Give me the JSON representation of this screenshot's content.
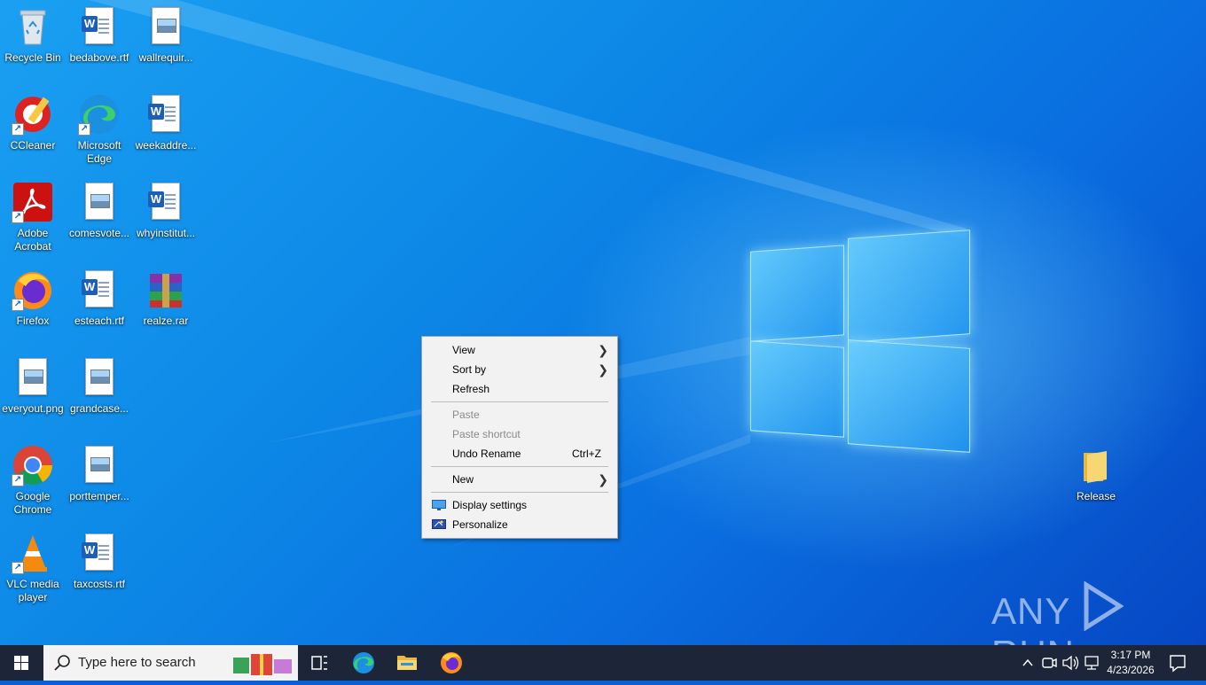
{
  "desktop": {
    "icons": [
      {
        "label": "Recycle Bin"
      },
      {
        "label": "bedabove.rtf"
      },
      {
        "label": "wallrequir..."
      },
      {
        "label": "CCleaner"
      },
      {
        "label": "Microsoft Edge"
      },
      {
        "label": "weekaddre..."
      },
      {
        "label": "Adobe Acrobat"
      },
      {
        "label": "comesvote..."
      },
      {
        "label": "whyinstitut..."
      },
      {
        "label": "Firefox"
      },
      {
        "label": "esteach.rtf"
      },
      {
        "label": "realze.rar"
      },
      {
        "label": "everyout.png"
      },
      {
        "label": "grandcase..."
      },
      {
        "label": "Google Chrome"
      },
      {
        "label": "porttemper..."
      },
      {
        "label": "VLC media player"
      },
      {
        "label": "taxcosts.rtf"
      },
      {
        "label": "Release"
      }
    ],
    "watermark": {
      "left": "ANY",
      "right": "RUN"
    }
  },
  "context_menu": {
    "items": [
      {
        "label": "View",
        "has_submenu": true
      },
      {
        "label": "Sort by",
        "has_submenu": true
      },
      {
        "label": "Refresh"
      },
      {
        "label": "Paste",
        "disabled": true
      },
      {
        "label": "Paste shortcut",
        "disabled": true
      },
      {
        "label": "Undo Rename",
        "shortcut": "Ctrl+Z"
      },
      {
        "label": "New",
        "has_submenu": true
      },
      {
        "label": "Display settings",
        "icon": "display-icon"
      },
      {
        "label": "Personalize",
        "icon": "personalize-icon"
      }
    ]
  },
  "taskbar": {
    "search_placeholder": "Type here to search",
    "clock_time": "3:17 PM",
    "clock_date": "4/23/2026",
    "pinned": [
      "task-view-icon",
      "edge-icon",
      "file-explorer-icon",
      "firefox-icon"
    ]
  },
  "colors": {
    "taskbar": "#1c2638",
    "menu_bg": "#f2f2f2",
    "desktop_accent": "#0c86e6"
  }
}
